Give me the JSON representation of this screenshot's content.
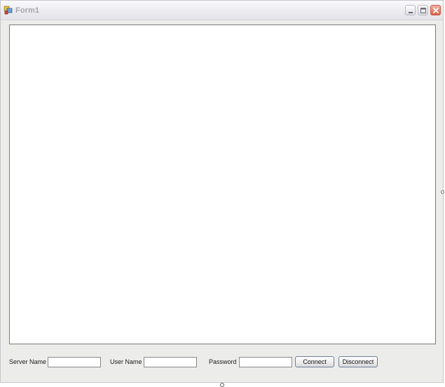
{
  "window": {
    "title": "Form1",
    "icons": {
      "app": "app-icon",
      "minimize": "minimize-icon",
      "maximize": "maximize-icon",
      "close": "close-icon"
    }
  },
  "connection_bar": {
    "server_name_label": "Server Name",
    "server_name_value": "",
    "user_name_label": "User Name",
    "user_name_value": "",
    "password_label": "Password",
    "password_value": "",
    "connect_label": "Connect",
    "disconnect_label": "Disconnect"
  },
  "colors": {
    "close_button": "#d8604a",
    "window_face": "#ececea",
    "title_text": "#a6a6ad"
  }
}
